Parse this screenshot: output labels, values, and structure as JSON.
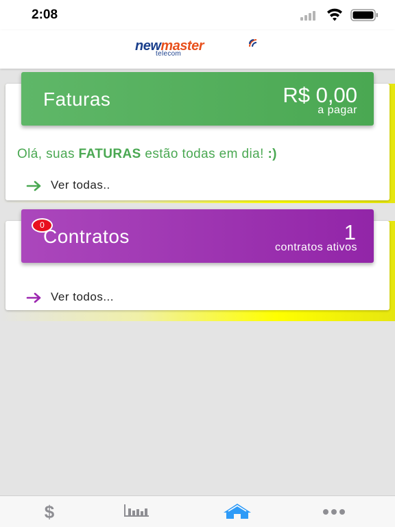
{
  "status_bar": {
    "time": "2:08"
  },
  "header": {
    "logo_new": "new",
    "logo_master": "master",
    "logo_sub": "telecom"
  },
  "faturas": {
    "title": "Faturas",
    "amount": "R$ 0,00",
    "amount_label": "a pagar",
    "message_prefix": "Olá, suas ",
    "message_bold": "FATURAS",
    "message_suffix": " estão todas em dia! ",
    "message_smiley": ":)",
    "link_label": "Ver todas.."
  },
  "contratos": {
    "title": "Contratos",
    "badge": "0",
    "count": "1",
    "count_label": "contratos ativos",
    "link_label": "Ver todos..."
  },
  "tab_bar": {
    "tabs": [
      {
        "icon": "dollar-icon",
        "label": "$"
      },
      {
        "icon": "bar-chart-icon"
      },
      {
        "icon": "home-icon",
        "active": true
      },
      {
        "icon": "more-icon"
      }
    ]
  },
  "colors": {
    "green": "#4aa852",
    "purple": "#9c27b0",
    "active_tab": "#2f9bf7",
    "inactive_tab": "#8e8e93",
    "badge": "#e8101e"
  }
}
